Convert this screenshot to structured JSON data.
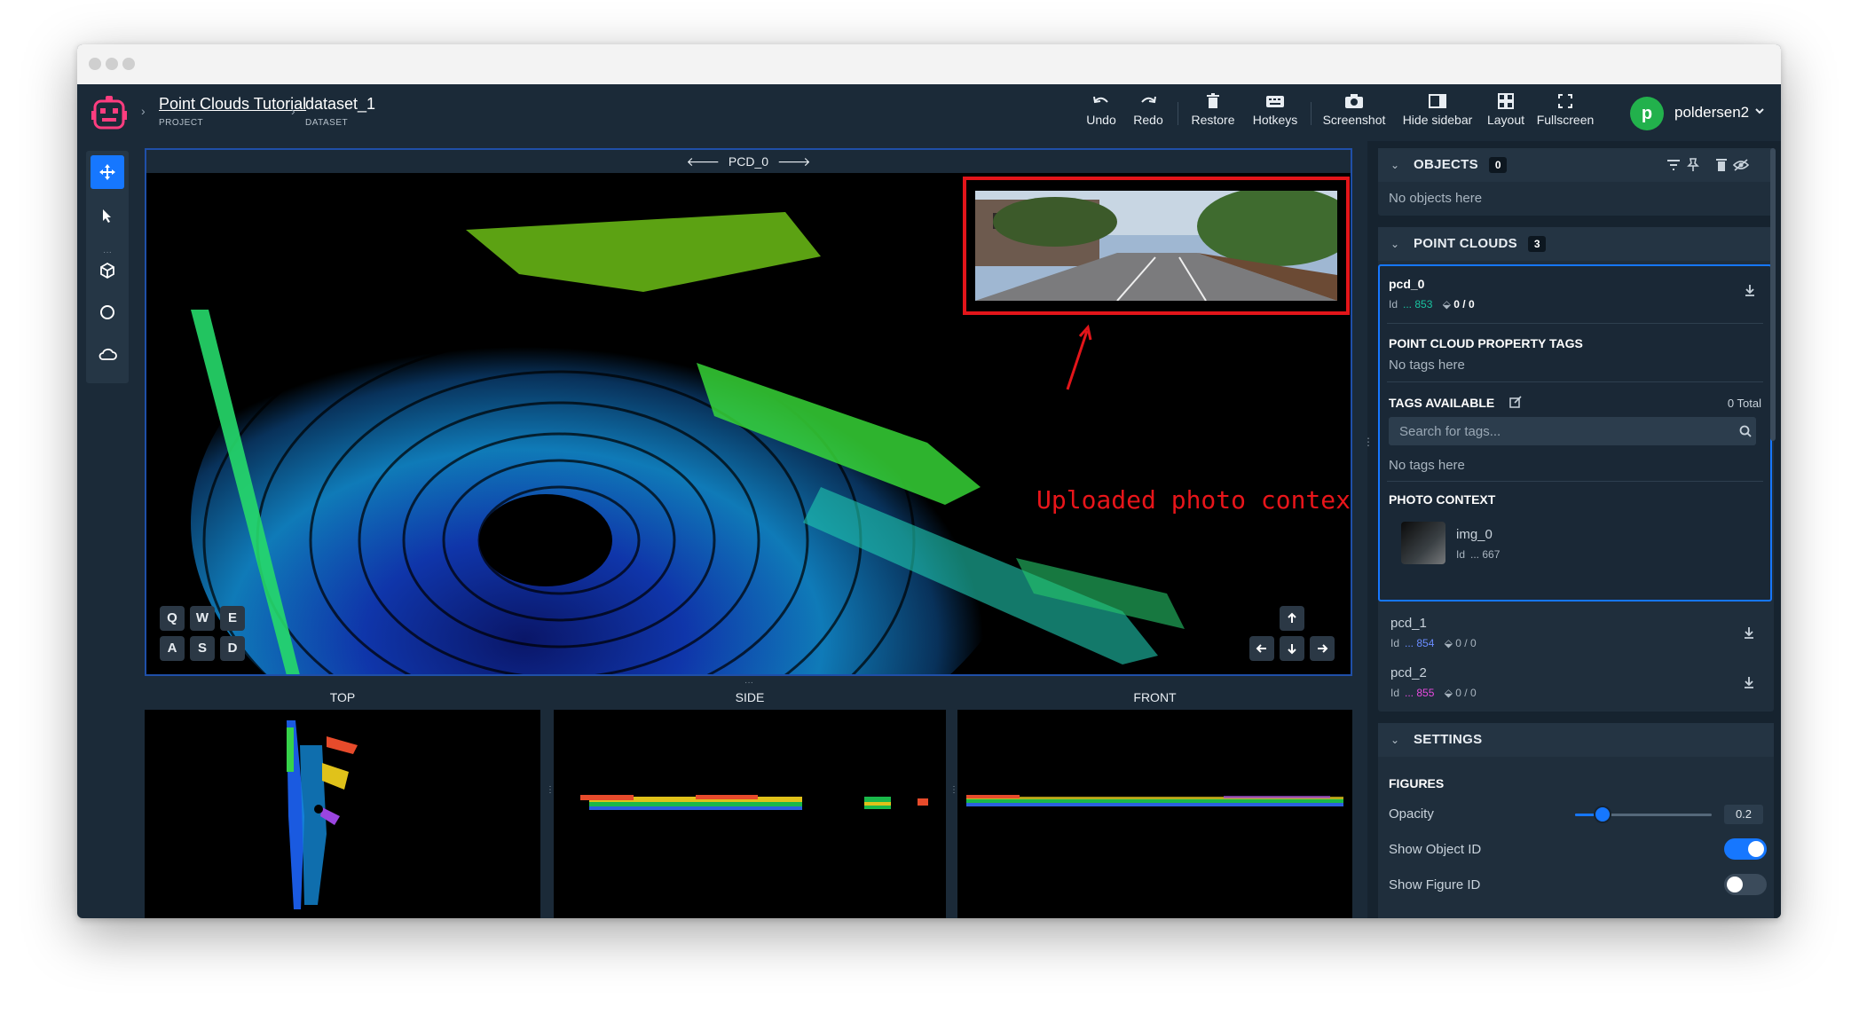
{
  "window_controls": [
    "close",
    "minimize",
    "zoom"
  ],
  "breadcrumb": {
    "project": {
      "name": "Point Clouds Tutorial",
      "type": "PROJECT"
    },
    "dataset": {
      "name": "dataset_1",
      "type": "DATASET"
    }
  },
  "toolbar": {
    "undo": "Undo",
    "redo": "Redo",
    "restore": "Restore",
    "hotkeys": "Hotkeys",
    "screenshot": "Screenshot",
    "hide_sidebar": "Hide sidebar",
    "layout": "Layout",
    "fullscreen": "Fullscreen"
  },
  "user": {
    "initial": "p",
    "name": "poldersen2",
    "avatar_color": "#22b14c"
  },
  "tools": [
    "move-icon",
    "cursor-icon",
    "cube-icon",
    "circle-icon",
    "cloud-icon"
  ],
  "main_view": {
    "title": "PCD_0",
    "annotation": "Uploaded photo context",
    "keys_row1": [
      "Q",
      "W",
      "E"
    ],
    "keys_row2": [
      "A",
      "S",
      "D"
    ]
  },
  "sub_views": {
    "top": "TOP",
    "side": "SIDE",
    "front": "FRONT"
  },
  "objects": {
    "title": "OBJECTS",
    "count": "0",
    "empty": "No objects here"
  },
  "point_clouds": {
    "title": "POINT CLOUDS",
    "count": "3",
    "items": [
      {
        "name": "pcd_0",
        "id_prefix": "Id",
        "id": "... 853",
        "figures": "0 / 0",
        "id_color": "#19c3a0"
      },
      {
        "name": "pcd_1",
        "id_prefix": "Id",
        "id": "... 854",
        "figures": "0 / 0",
        "id_color": "#6a8cff"
      },
      {
        "name": "pcd_2",
        "id_prefix": "Id",
        "id": "... 855",
        "figures": "0 / 0",
        "id_color": "#e84be0"
      }
    ],
    "property_tags_title": "POINT CLOUD PROPERTY TAGS",
    "property_tags_empty": "No tags here",
    "tags_available_title": "TAGS AVAILABLE",
    "tags_total": "0 Total",
    "search_placeholder": "Search for tags...",
    "tags_empty": "No tags here",
    "photo_context_title": "PHOTO CONTEXT",
    "photo": {
      "name": "img_0",
      "id_prefix": "Id",
      "id": "... 667"
    }
  },
  "settings": {
    "title": "SETTINGS",
    "figures_title": "FIGURES",
    "opacity_label": "Opacity",
    "opacity_value": "0.2",
    "opacity_fraction": 0.2,
    "show_object_id": "Show Object ID",
    "show_object_id_on": true,
    "show_figure_id": "Show Figure ID",
    "show_figure_id_on": false
  },
  "colors": {
    "accent": "#1677ff",
    "annotation_red": "#e3151a",
    "header_bg": "#1b2a38"
  }
}
